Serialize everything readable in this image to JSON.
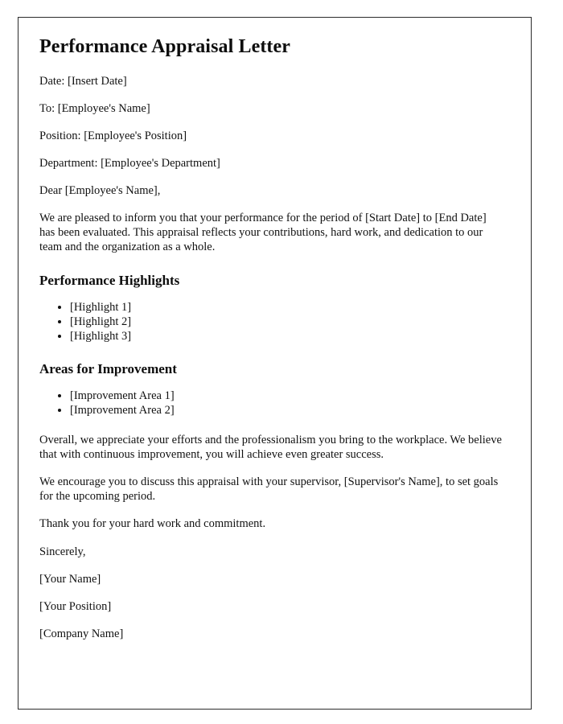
{
  "document": {
    "title": "Performance Appraisal Letter",
    "meta": [
      {
        "key": "date",
        "text": "Date: [Insert Date]"
      },
      {
        "key": "to",
        "text": "To: [Employee's Name]"
      },
      {
        "key": "position",
        "text": "Position: [Employee's Position]"
      },
      {
        "key": "department",
        "text": "Department: [Employee's Department]"
      }
    ],
    "salutation": "Dear [Employee's Name],",
    "intro_paragraph": "We are pleased to inform you that your performance for the period of [Start Date] to [End Date] has been evaluated. This appraisal reflects your contributions, hard work, and dedication to our team and the organization as a whole.",
    "sections": [
      {
        "heading": "Performance Highlights",
        "items": [
          "[Highlight 1]",
          "[Highlight 2]",
          "[Highlight 3]"
        ]
      },
      {
        "heading": "Areas for Improvement",
        "items": [
          "[Improvement Area 1]",
          "[Improvement Area 2]"
        ]
      }
    ],
    "closing_paragraphs": [
      "Overall, we appreciate your efforts and the professionalism you bring to the workplace. We believe that with continuous improvement, you will achieve even greater success.",
      "We encourage you to discuss this appraisal with your supervisor, [Supervisor's Name], to set goals for the upcoming period.",
      "Thank you for your hard work and commitment."
    ],
    "signoff": "Sincerely,",
    "signature_lines": [
      "[Your Name]",
      "[Your Position]",
      "[Company Name]"
    ]
  }
}
